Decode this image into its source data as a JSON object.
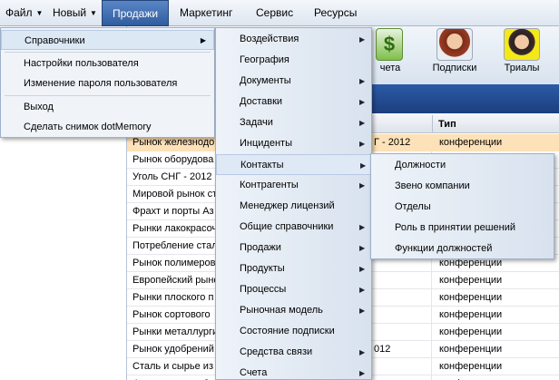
{
  "menubar": {
    "items": [
      {
        "label": "Файл",
        "has_arrow": true
      },
      {
        "label": "Новый",
        "has_arrow": true
      },
      {
        "label": "Продажи",
        "active": true
      },
      {
        "label": "Маркетинг"
      },
      {
        "label": "Сервис"
      },
      {
        "label": "Ресурсы"
      }
    ]
  },
  "toolbar": {
    "buttons": [
      {
        "label": "чета",
        "icon": "invoice-icon"
      },
      {
        "label": "Подписки",
        "icon": "subscription-icon"
      },
      {
        "label": "Триалы",
        "icon": "trial-icon"
      }
    ]
  },
  "grid": {
    "header_type": "Тип",
    "rows": [
      {
        "name": "Рынок железнодо",
        "mid": "Г - 2012",
        "type": "конференции",
        "selected": true
      },
      {
        "name": "Рынок оборудова",
        "mid": "",
        "type": ""
      },
      {
        "name": "Уголь СНГ - 2012",
        "mid": "",
        "type": ""
      },
      {
        "name": "Мировой рынок ст",
        "mid": "",
        "type": ""
      },
      {
        "name": "Фрахт и порты Аз",
        "mid": "",
        "type": ""
      },
      {
        "name": "Рынки лакокрасоч",
        "mid": "",
        "type": ""
      },
      {
        "name": "Потребление стал",
        "mid": "",
        "type": ""
      },
      {
        "name": "Рынок полимеров",
        "mid": "",
        "type": "конференции"
      },
      {
        "name": "Европейский рынс",
        "mid": "",
        "type": "конференции"
      },
      {
        "name": "Рынки плоского п",
        "mid": "",
        "type": "конференции"
      },
      {
        "name": "Рынок сортового",
        "mid": "",
        "type": "конференции"
      },
      {
        "name": "Рынки металлурги",
        "mid": "",
        "type": "конференции"
      },
      {
        "name": "Рынок удобрений",
        "mid": "012",
        "type": "конференции"
      },
      {
        "name": "Сталь и сырье из",
        "mid": "",
        "type": "конференции"
      },
      {
        "name": "Фрахт и порты Ср",
        "mid": "",
        "type": "конференции"
      }
    ]
  },
  "menu_sales": {
    "items": [
      {
        "label": "Справочники",
        "submenu": true,
        "highlighted": true
      },
      {
        "label": "Настройки пользователя"
      },
      {
        "label": "Изменение пароля пользователя"
      },
      {
        "label": "Выход"
      },
      {
        "label": "Сделать снимок dotMemory"
      }
    ]
  },
  "menu_directories": {
    "items": [
      {
        "label": "Воздействия",
        "submenu": true
      },
      {
        "label": "География",
        "submenu": false
      },
      {
        "label": "Документы",
        "submenu": true
      },
      {
        "label": "Доставки",
        "submenu": true
      },
      {
        "label": "Задачи",
        "submenu": true
      },
      {
        "label": "Инциденты",
        "submenu": true
      },
      {
        "label": "Контакты",
        "submenu": true,
        "highlighted": true
      },
      {
        "label": "Контрагенты",
        "submenu": true
      },
      {
        "label": "Менеджер лицензий",
        "submenu": false
      },
      {
        "label": "Общие справочники",
        "submenu": true
      },
      {
        "label": "Продажи",
        "submenu": true
      },
      {
        "label": "Продукты",
        "submenu": true
      },
      {
        "label": "Процессы",
        "submenu": true
      },
      {
        "label": "Рыночная модель",
        "submenu": true
      },
      {
        "label": "Состояние подписки",
        "submenu": false
      },
      {
        "label": "Средства связи",
        "submenu": true
      },
      {
        "label": "Счета",
        "submenu": true
      }
    ]
  },
  "menu_contacts": {
    "items": [
      {
        "label": "Должности"
      },
      {
        "label": "Звено компании"
      },
      {
        "label": "Отделы"
      },
      {
        "label": "Роль в принятии решений"
      },
      {
        "label": "Функции должностей"
      }
    ]
  }
}
